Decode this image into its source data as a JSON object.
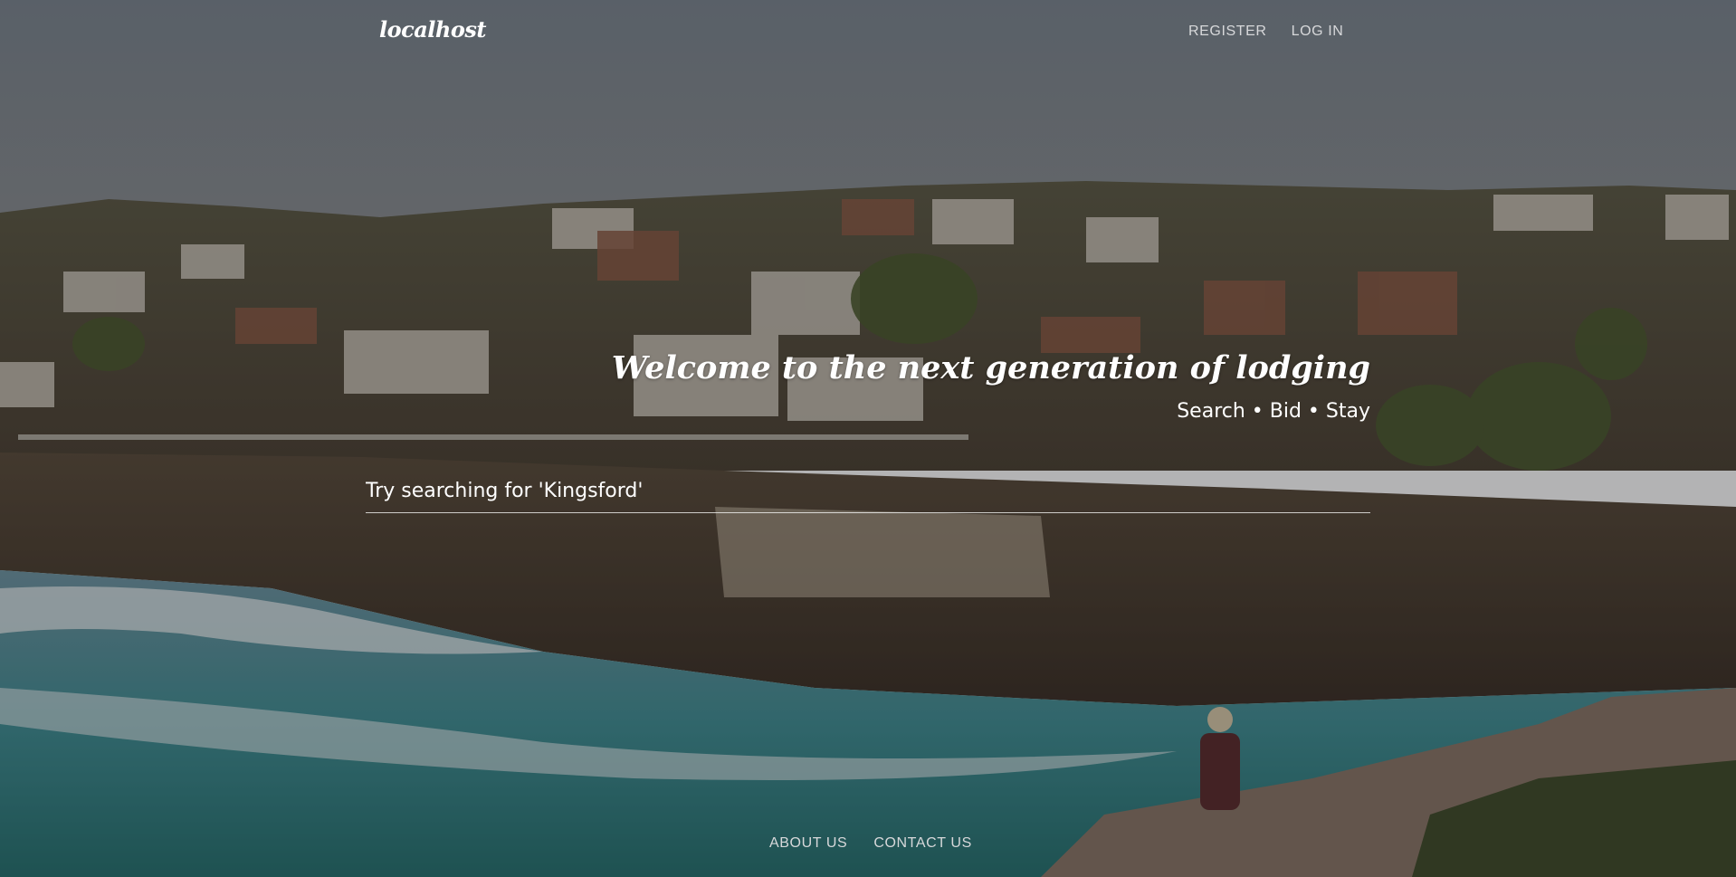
{
  "navbar": {
    "brand": "localhost",
    "links": {
      "register": "REGISTER",
      "login": "LOG IN"
    }
  },
  "hero": {
    "title": "Welcome to the next generation of lodging",
    "subtitle": "Search • Bid • Stay"
  },
  "search": {
    "placeholder": "Try searching for 'Kingsford'",
    "value": ""
  },
  "footer": {
    "about": "ABOUT US",
    "contact": "CONTACT US"
  },
  "colors": {
    "sky": "#6e7a85",
    "text": "#ffffff",
    "nav_text": "#d7d8da",
    "sea": "#2d8a86"
  }
}
